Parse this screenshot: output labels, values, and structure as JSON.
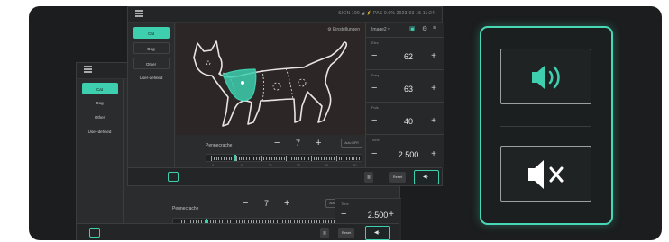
{
  "status_bar": "SIGN  100 ◢  ⚡  PAS  0.0%  2023-03-15 11:24",
  "sidebar": {
    "items": [
      {
        "label": "Cat",
        "active": true
      },
      {
        "label": "Dog",
        "active": false
      },
      {
        "label": "Other",
        "active": false
      },
      {
        "label": "User-defined",
        "active": false
      }
    ]
  },
  "front": {
    "canvas_header": "Einstellungen",
    "canvas_dropdown": "Image2 ▾",
    "rows": [
      {
        "label": "Elec",
        "value": "62"
      },
      {
        "label": "Freq",
        "value": "63"
      },
      {
        "label": "Puls",
        "value": "40"
      },
      {
        "label": "Time",
        "value": "2.500"
      }
    ],
    "slider": {
      "title": "Pennecrache",
      "value": "7",
      "auto": "Auto NPR",
      "tick_labels": [
        "0",
        "10",
        "20",
        "30",
        "40",
        "50"
      ],
      "level_percent": 18
    },
    "bottom": {
      "preset_label": "Reset"
    }
  },
  "back": {
    "slider": {
      "title": "Pennecrache",
      "value": "7",
      "auto": "Auto NPR",
      "tick_labels": [
        "0",
        "10",
        "20",
        "30",
        "40",
        "50"
      ],
      "level_percent": 18
    },
    "row": {
      "label": "Time",
      "value": "2.500"
    },
    "bottom": {
      "preset_label": "Reset"
    }
  },
  "colors": {
    "accent": "#3ecfae",
    "panel_glow": "#49d8b6",
    "background": "#1b1d1e"
  },
  "sound_panel": {
    "on_icon": "speaker-on-icon",
    "mute_icon": "speaker-mute-icon"
  }
}
